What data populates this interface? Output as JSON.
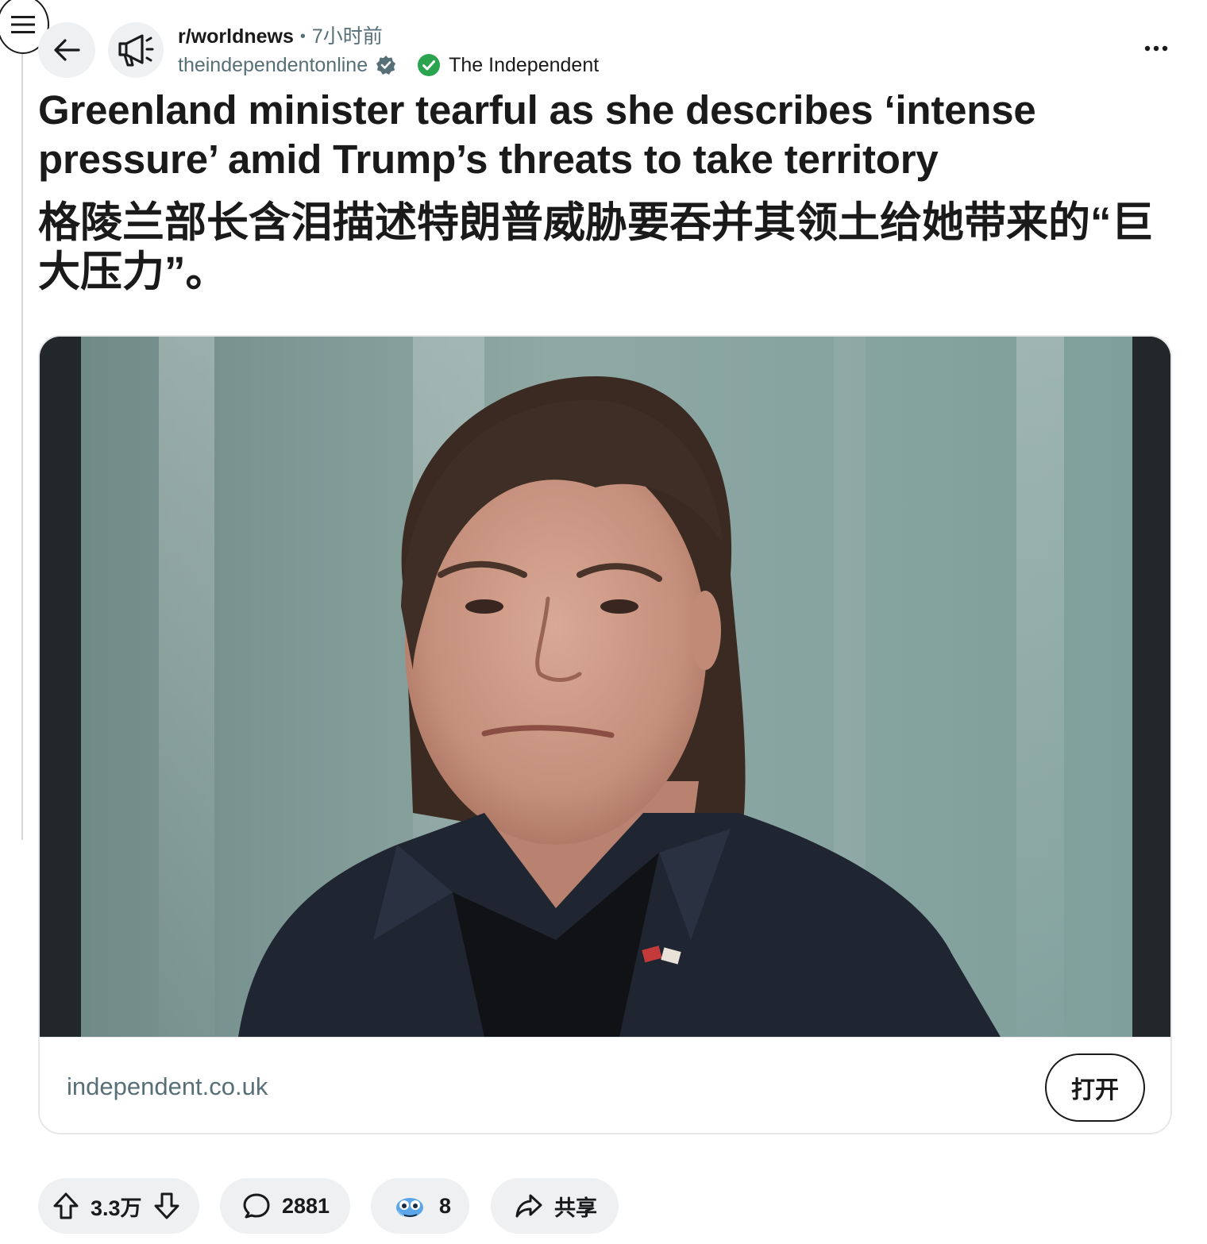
{
  "header": {
    "subreddit": "r/worldnews",
    "separator": "•",
    "time_ago": "7小时前",
    "author": "theindependentonline",
    "source_flair": "The Independent"
  },
  "post": {
    "title_en": "Greenland minister tearful as she describes ‘intense pressure’ amid Trump’s threats to take territory",
    "title_zh": "格陵兰部长含泪描述特朗普威胁要吞并其领土给她带来的“巨大压力”。"
  },
  "link_card": {
    "domain": "independent.co.uk",
    "open_label": "打开"
  },
  "actions": {
    "votes": "3.3万",
    "comments": "2881",
    "awards": "8",
    "share_label": "共享"
  },
  "icons": {
    "menu": "menu-icon",
    "back": "back-arrow-icon",
    "subreddit": "megaphone-icon",
    "verified": "verified-badge-icon",
    "flair": "check-circle-icon",
    "more": "more-options-icon",
    "upvote": "upvote-arrow-icon",
    "downvote": "downvote-arrow-icon",
    "comment": "comment-bubble-icon",
    "award": "award-icon",
    "share": "share-arrow-icon"
  },
  "colors": {
    "text": "#1a1a1b",
    "muted": "#576f76",
    "pill_bg": "#eef0f2",
    "verified_green": "#2aa44f",
    "border": "#e5e7e9"
  }
}
